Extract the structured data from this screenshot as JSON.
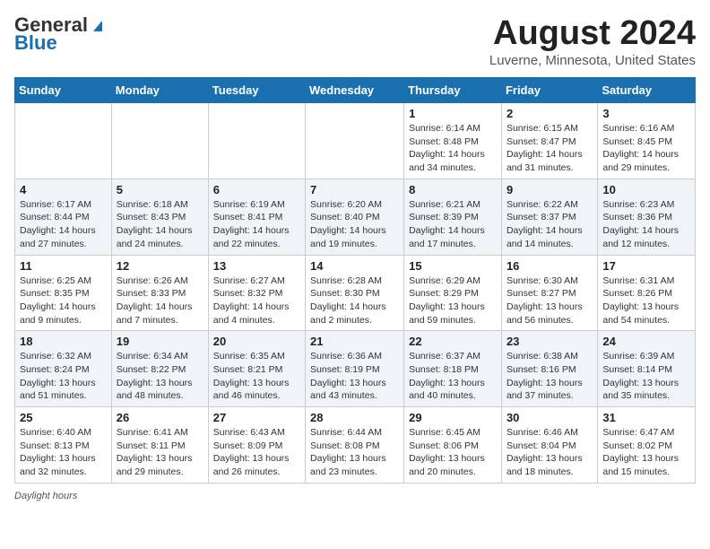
{
  "header": {
    "logo_general": "General",
    "logo_blue": "Blue",
    "month": "August 2024",
    "location": "Luverne, Minnesota, United States"
  },
  "weekdays": [
    "Sunday",
    "Monday",
    "Tuesday",
    "Wednesday",
    "Thursday",
    "Friday",
    "Saturday"
  ],
  "weeks": [
    [
      {
        "day": "",
        "info": ""
      },
      {
        "day": "",
        "info": ""
      },
      {
        "day": "",
        "info": ""
      },
      {
        "day": "",
        "info": ""
      },
      {
        "day": "1",
        "info": "Sunrise: 6:14 AM\nSunset: 8:48 PM\nDaylight: 14 hours and 34 minutes."
      },
      {
        "day": "2",
        "info": "Sunrise: 6:15 AM\nSunset: 8:47 PM\nDaylight: 14 hours and 31 minutes."
      },
      {
        "day": "3",
        "info": "Sunrise: 6:16 AM\nSunset: 8:45 PM\nDaylight: 14 hours and 29 minutes."
      }
    ],
    [
      {
        "day": "4",
        "info": "Sunrise: 6:17 AM\nSunset: 8:44 PM\nDaylight: 14 hours and 27 minutes."
      },
      {
        "day": "5",
        "info": "Sunrise: 6:18 AM\nSunset: 8:43 PM\nDaylight: 14 hours and 24 minutes."
      },
      {
        "day": "6",
        "info": "Sunrise: 6:19 AM\nSunset: 8:41 PM\nDaylight: 14 hours and 22 minutes."
      },
      {
        "day": "7",
        "info": "Sunrise: 6:20 AM\nSunset: 8:40 PM\nDaylight: 14 hours and 19 minutes."
      },
      {
        "day": "8",
        "info": "Sunrise: 6:21 AM\nSunset: 8:39 PM\nDaylight: 14 hours and 17 minutes."
      },
      {
        "day": "9",
        "info": "Sunrise: 6:22 AM\nSunset: 8:37 PM\nDaylight: 14 hours and 14 minutes."
      },
      {
        "day": "10",
        "info": "Sunrise: 6:23 AM\nSunset: 8:36 PM\nDaylight: 14 hours and 12 minutes."
      }
    ],
    [
      {
        "day": "11",
        "info": "Sunrise: 6:25 AM\nSunset: 8:35 PM\nDaylight: 14 hours and 9 minutes."
      },
      {
        "day": "12",
        "info": "Sunrise: 6:26 AM\nSunset: 8:33 PM\nDaylight: 14 hours and 7 minutes."
      },
      {
        "day": "13",
        "info": "Sunrise: 6:27 AM\nSunset: 8:32 PM\nDaylight: 14 hours and 4 minutes."
      },
      {
        "day": "14",
        "info": "Sunrise: 6:28 AM\nSunset: 8:30 PM\nDaylight: 14 hours and 2 minutes."
      },
      {
        "day": "15",
        "info": "Sunrise: 6:29 AM\nSunset: 8:29 PM\nDaylight: 13 hours and 59 minutes."
      },
      {
        "day": "16",
        "info": "Sunrise: 6:30 AM\nSunset: 8:27 PM\nDaylight: 13 hours and 56 minutes."
      },
      {
        "day": "17",
        "info": "Sunrise: 6:31 AM\nSunset: 8:26 PM\nDaylight: 13 hours and 54 minutes."
      }
    ],
    [
      {
        "day": "18",
        "info": "Sunrise: 6:32 AM\nSunset: 8:24 PM\nDaylight: 13 hours and 51 minutes."
      },
      {
        "day": "19",
        "info": "Sunrise: 6:34 AM\nSunset: 8:22 PM\nDaylight: 13 hours and 48 minutes."
      },
      {
        "day": "20",
        "info": "Sunrise: 6:35 AM\nSunset: 8:21 PM\nDaylight: 13 hours and 46 minutes."
      },
      {
        "day": "21",
        "info": "Sunrise: 6:36 AM\nSunset: 8:19 PM\nDaylight: 13 hours and 43 minutes."
      },
      {
        "day": "22",
        "info": "Sunrise: 6:37 AM\nSunset: 8:18 PM\nDaylight: 13 hours and 40 minutes."
      },
      {
        "day": "23",
        "info": "Sunrise: 6:38 AM\nSunset: 8:16 PM\nDaylight: 13 hours and 37 minutes."
      },
      {
        "day": "24",
        "info": "Sunrise: 6:39 AM\nSunset: 8:14 PM\nDaylight: 13 hours and 35 minutes."
      }
    ],
    [
      {
        "day": "25",
        "info": "Sunrise: 6:40 AM\nSunset: 8:13 PM\nDaylight: 13 hours and 32 minutes."
      },
      {
        "day": "26",
        "info": "Sunrise: 6:41 AM\nSunset: 8:11 PM\nDaylight: 13 hours and 29 minutes."
      },
      {
        "day": "27",
        "info": "Sunrise: 6:43 AM\nSunset: 8:09 PM\nDaylight: 13 hours and 26 minutes."
      },
      {
        "day": "28",
        "info": "Sunrise: 6:44 AM\nSunset: 8:08 PM\nDaylight: 13 hours and 23 minutes."
      },
      {
        "day": "29",
        "info": "Sunrise: 6:45 AM\nSunset: 8:06 PM\nDaylight: 13 hours and 20 minutes."
      },
      {
        "day": "30",
        "info": "Sunrise: 6:46 AM\nSunset: 8:04 PM\nDaylight: 13 hours and 18 minutes."
      },
      {
        "day": "31",
        "info": "Sunrise: 6:47 AM\nSunset: 8:02 PM\nDaylight: 13 hours and 15 minutes."
      }
    ]
  ],
  "footer": {
    "note": "Daylight hours"
  }
}
